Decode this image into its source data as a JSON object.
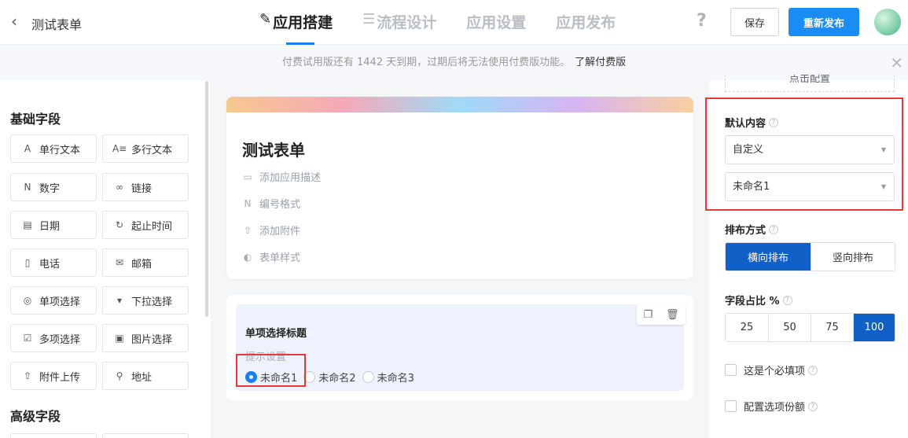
{
  "header": {
    "back_icon": "chevron-left-icon",
    "app_title": "测试表单",
    "tabs": [
      {
        "label": "应用搭建",
        "icon": "edit-icon"
      },
      {
        "label": "流程设计",
        "icon": "flow-icon"
      },
      {
        "label": "应用设置",
        "icon": ""
      },
      {
        "label": "应用发布",
        "icon": ""
      }
    ],
    "help_label": "?",
    "save_label": "保存",
    "republish_label": "重新发布"
  },
  "notice": {
    "text": "付费试用版还有 1442 天到期，过期后将无法使用付费版功能。",
    "link": "了解付费版",
    "close": "✕"
  },
  "left": {
    "basic_title": "基础字段",
    "advanced_title": "高级字段",
    "fields": [
      {
        "label": "单行文本",
        "icon": "A"
      },
      {
        "label": "多行文本",
        "icon": "A≡"
      },
      {
        "label": "数字",
        "icon": "N"
      },
      {
        "label": "链接",
        "icon": "∞"
      },
      {
        "label": "日期",
        "icon": "▤"
      },
      {
        "label": "起止时间",
        "icon": "↻"
      },
      {
        "label": "电话",
        "icon": "▯"
      },
      {
        "label": "邮箱",
        "icon": "✉"
      },
      {
        "label": "单项选择",
        "icon": "◎"
      },
      {
        "label": "下拉选择",
        "icon": "▾"
      },
      {
        "label": "多项选择",
        "icon": "☑"
      },
      {
        "label": "图片选择",
        "icon": "▣"
      },
      {
        "label": "附件上传",
        "icon": "⇧"
      },
      {
        "label": "地址",
        "icon": "⚲"
      }
    ]
  },
  "form": {
    "title": "测试表单",
    "options": [
      {
        "label": "添加应用描述",
        "icon": "▭"
      },
      {
        "label": "编号格式",
        "icon": "N"
      },
      {
        "label": "添加附件",
        "icon": "⇧"
      },
      {
        "label": "表单样式",
        "icon": "◐"
      }
    ],
    "field": {
      "label": "单项选择标题",
      "hint": "提示设置",
      "choices": [
        {
          "label": "未命名1",
          "checked": true
        },
        {
          "label": "未命名2",
          "checked": false
        },
        {
          "label": "未命名3",
          "checked": false
        }
      ],
      "copy_icon": "❐",
      "delete_icon": "🗑"
    }
  },
  "right": {
    "cut_label": "点击配置",
    "default_label": "默认内容",
    "default_mode": "自定义",
    "default_value": "未命名1",
    "layout_label": "排布方式",
    "layout_options": [
      {
        "label": "横向排布",
        "on": true
      },
      {
        "label": "竖向排布",
        "on": false
      }
    ],
    "ratio_label": "字段占比 %",
    "ratio_options": [
      {
        "label": "25",
        "on": false
      },
      {
        "label": "50",
        "on": false
      },
      {
        "label": "75",
        "on": false
      },
      {
        "label": "100",
        "on": true
      }
    ],
    "required_label": "这是个必填项",
    "quota_label": "配置选项份额",
    "caret": "▼",
    "qmark": "?"
  },
  "colors": {
    "accent": "#1a8cf5",
    "segment_on": "#1060c8",
    "highlight": "#e53935"
  }
}
